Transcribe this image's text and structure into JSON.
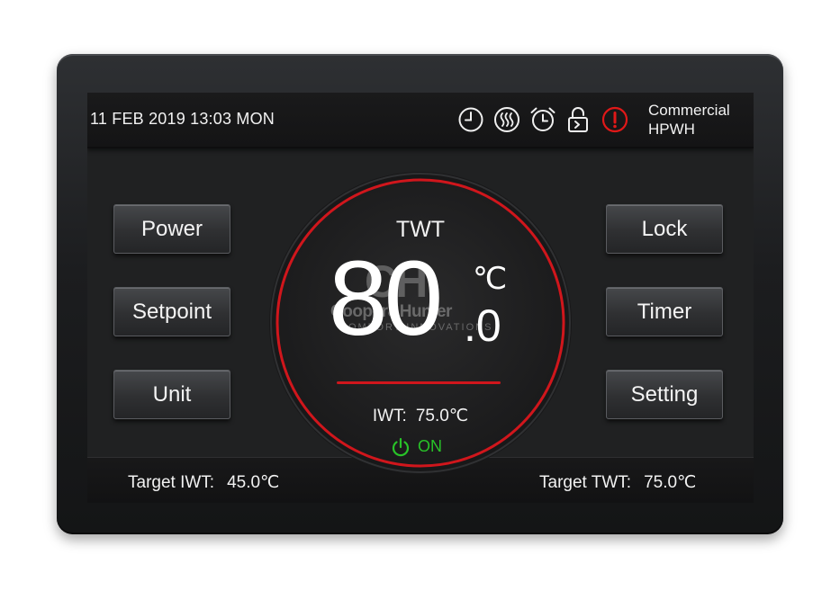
{
  "header": {
    "datetime": "11 FEB 2019 13:03 MON",
    "product_line1": "Commercial",
    "product_line2": "HPWH",
    "status_icons": [
      "clock-icon",
      "heating-icon",
      "alarm-clock-icon",
      "lock-icon",
      "warning-icon"
    ]
  },
  "buttons": {
    "power": "Power",
    "setpoint": "Setpoint",
    "unit": "Unit",
    "lock": "Lock",
    "timer": "Timer",
    "setting": "Setting"
  },
  "dial": {
    "label": "TWT",
    "value_integer": "80",
    "value_decimal": ".0",
    "unit": "℃",
    "iwt_label": "IWT:",
    "iwt_value": "75.0℃",
    "power_state": "ON"
  },
  "watermark": {
    "logo": "CH",
    "brand": "Cooper&Hunter",
    "tagline": "COMFORT INNOVATIONS"
  },
  "footer": {
    "target_iwt_label": "Target IWT:",
    "target_iwt_value": "45.0℃",
    "target_twt_label": "Target TWT:",
    "target_twt_value": "75.0℃"
  },
  "colors": {
    "accent_red": "#d0161c",
    "on_green": "#28c228",
    "warning_red": "#e01818"
  }
}
